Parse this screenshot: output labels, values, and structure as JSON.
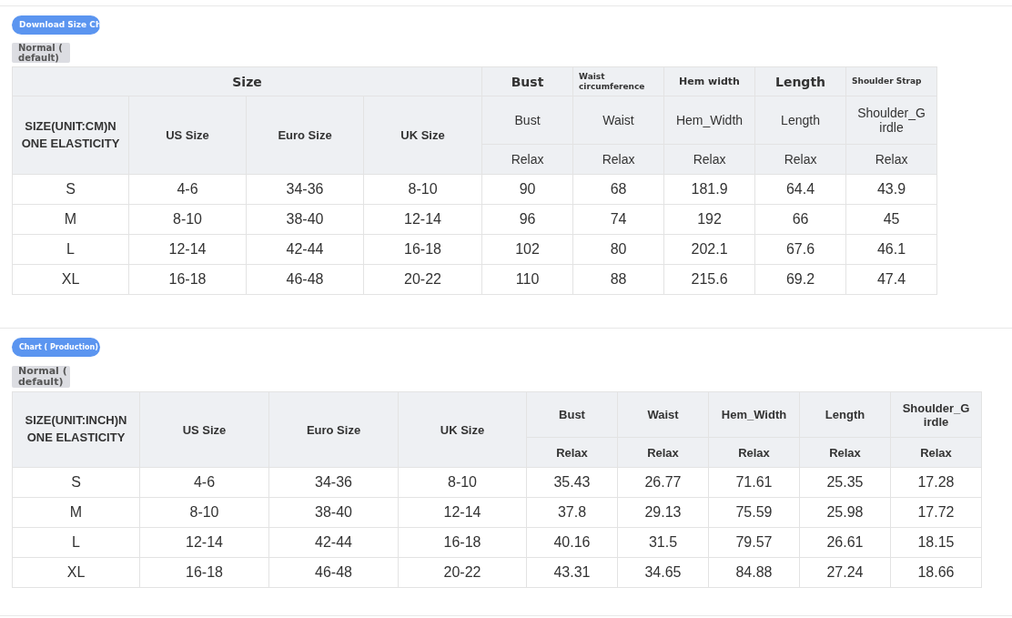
{
  "sections": [
    {
      "button": "Download Size Ch",
      "tag": "Normal ( default)",
      "table": {
        "size_group": "Size",
        "measure_groups": [
          "Bust",
          "Waist circumference",
          "Hem width",
          "Length",
          "Shoulder Strap"
        ],
        "size_columns": [
          "SIZE(UNIT:CM)N ONE ELASTICITY",
          "US Size",
          "Euro Size",
          "UK Size"
        ],
        "measure_columns": [
          "Bust",
          "Waist",
          "Hem_Width",
          "Length",
          "Shoulder_G irdle"
        ],
        "fit_labels": [
          "Relax",
          "Relax",
          "Relax",
          "Relax",
          "Relax"
        ],
        "rows": [
          [
            "S",
            "4-6",
            "34-36",
            "8-10",
            "90",
            "68",
            "181.9",
            "64.4",
            "43.9"
          ],
          [
            "M",
            "8-10",
            "38-40",
            "12-14",
            "96",
            "74",
            "192",
            "66",
            "45"
          ],
          [
            "L",
            "12-14",
            "42-44",
            "16-18",
            "102",
            "80",
            "202.1",
            "67.6",
            "46.1"
          ],
          [
            "XL",
            "16-18",
            "46-48",
            "20-22",
            "110",
            "88",
            "215.6",
            "69.2",
            "47.4"
          ]
        ]
      }
    },
    {
      "button": "Chart ( Production)",
      "tag": "Normal ( default)",
      "table": {
        "size_columns": [
          "SIZE(UNIT:INCH)N ONE ELASTICITY",
          "US Size",
          "Euro Size",
          "UK Size"
        ],
        "measure_columns": [
          "Bust",
          "Waist",
          "Hem_Width",
          "Length",
          "Shoulder_G irdle"
        ],
        "fit_labels": [
          "Relax",
          "Relax",
          "Relax",
          "Relax",
          "Relax"
        ],
        "rows": [
          [
            "S",
            "4-6",
            "34-36",
            "8-10",
            "35.43",
            "26.77",
            "71.61",
            "25.35",
            "17.28"
          ],
          [
            "M",
            "8-10",
            "38-40",
            "12-14",
            "37.8",
            "29.13",
            "75.59",
            "25.98",
            "17.72"
          ],
          [
            "L",
            "12-14",
            "42-44",
            "16-18",
            "40.16",
            "31.5",
            "79.57",
            "26.61",
            "18.15"
          ],
          [
            "XL",
            "16-18",
            "46-48",
            "20-22",
            "43.31",
            "34.65",
            "84.88",
            "27.24",
            "18.66"
          ]
        ]
      }
    }
  ]
}
